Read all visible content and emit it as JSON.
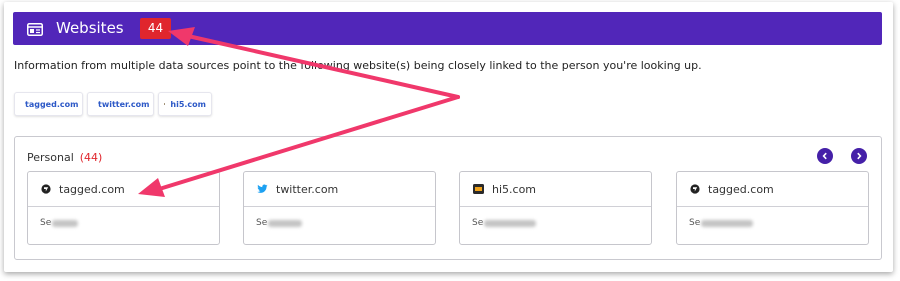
{
  "header": {
    "title": "Websites",
    "count": "44"
  },
  "info_text": "Information from multiple data sources point to the following website(s) being closely linked to the person you're looking up.",
  "chips": [
    {
      "label": "tagged.com",
      "icon": "tagged-icon"
    },
    {
      "label": "twitter.com",
      "icon": "twitter-icon"
    },
    {
      "label": "hi5.com",
      "icon": "hi5-icon"
    }
  ],
  "section": {
    "label": "Personal",
    "count": "(44)"
  },
  "cards": [
    {
      "site": "tagged.com",
      "icon": "tagged-icon",
      "detail_prefix": "Se"
    },
    {
      "site": "twitter.com",
      "icon": "twitter-icon",
      "detail_prefix": "Se"
    },
    {
      "site": "hi5.com",
      "icon": "hi5-icon",
      "detail_prefix": "Se"
    },
    {
      "site": "tagged.com",
      "icon": "tagged-icon",
      "detail_prefix": "Se"
    }
  ],
  "colors": {
    "header_bg": "#5126b9",
    "count_badge": "#e0262d",
    "nav_button": "#4520a8",
    "annotation_arrow": "#f0386b",
    "twitter_blue": "#1da1f2"
  }
}
